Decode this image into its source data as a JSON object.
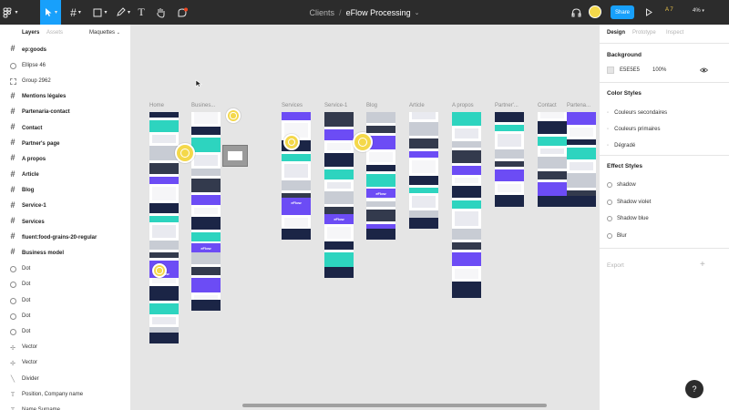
{
  "toolbar": {
    "breadcrumb": "Clients",
    "separator": "/",
    "file_name": "eFlow Processing",
    "caret": "⌄",
    "share_label": "Share",
    "multiplayer_label": "A 7",
    "zoom": "4%"
  },
  "left_panel": {
    "tabs": {
      "layers": "Layers",
      "assets": "Assets",
      "page": "Maquettes",
      "page_caret": "⌄"
    },
    "layers": [
      {
        "label": "ep:goods",
        "icon": "frame-icon",
        "bold": true
      },
      {
        "label": "Ellipse 46",
        "icon": "ellipse-icon",
        "bold": false
      },
      {
        "label": "Group 2962",
        "icon": "group-icon",
        "bold": false
      },
      {
        "label": "Mentions légales",
        "icon": "frame-icon",
        "bold": true
      },
      {
        "label": "Partenaria-contact",
        "icon": "frame-icon",
        "bold": true
      },
      {
        "label": "Contact",
        "icon": "frame-icon",
        "bold": true
      },
      {
        "label": "Partner's page",
        "icon": "frame-icon",
        "bold": true
      },
      {
        "label": "A propos",
        "icon": "frame-icon",
        "bold": true
      },
      {
        "label": "Article",
        "icon": "frame-icon",
        "bold": true
      },
      {
        "label": "Blog",
        "icon": "frame-icon",
        "bold": true
      },
      {
        "label": "Service-1",
        "icon": "frame-icon",
        "bold": true
      },
      {
        "label": "Services",
        "icon": "frame-icon",
        "bold": true
      },
      {
        "label": "fluent:food-grains-20-regular",
        "icon": "frame-icon",
        "bold": true
      },
      {
        "label": "Business model",
        "icon": "frame-icon",
        "bold": true
      },
      {
        "label": "Dot",
        "icon": "ellipse-icon",
        "bold": false
      },
      {
        "label": "Dot",
        "icon": "ellipse-icon",
        "bold": false
      },
      {
        "label": "Dot",
        "icon": "ellipse-icon",
        "bold": false
      },
      {
        "label": "Dot",
        "icon": "ellipse-icon",
        "bold": false
      },
      {
        "label": "Dot",
        "icon": "ellipse-icon",
        "bold": false
      },
      {
        "label": "Vector",
        "icon": "vector-icon",
        "bold": false
      },
      {
        "label": "Vector",
        "icon": "vector-icon",
        "bold": false
      },
      {
        "label": "Divider",
        "icon": "divider-icon",
        "bold": false
      },
      {
        "label": "Position, Company name",
        "icon": "text-icon",
        "bold": false
      },
      {
        "label": "Name Surname",
        "icon": "text-icon",
        "bold": false
      }
    ]
  },
  "canvas": {
    "frames": [
      {
        "label": "Home"
      },
      {
        "label": "Busines..."
      },
      {
        "label": "Services"
      },
      {
        "label": "Service-1"
      },
      {
        "label": "Blog"
      },
      {
        "label": "Article"
      },
      {
        "label": "A propos"
      },
      {
        "label": "Partner'..."
      },
      {
        "label": "Contact"
      },
      {
        "label": "Partena..."
      }
    ],
    "frame_texts": {
      "eflow": "eFlow"
    }
  },
  "right_panel": {
    "tabs": {
      "design": "Design",
      "prototype": "Prototype",
      "inspect": "Inspect"
    },
    "background": {
      "title": "Background",
      "color": "E5E5E5",
      "opacity": "100%"
    },
    "color_styles": {
      "title": "Color Styles",
      "items": [
        "Couleurs secondaires",
        "Couleurs primaires",
        "Dégradé"
      ]
    },
    "effect_styles": {
      "title": "Effect Styles",
      "items": [
        "shadow",
        "Shadow violet",
        "Shadow blue",
        "Blur"
      ]
    },
    "export": {
      "title": "Export",
      "add": "+"
    }
  },
  "help": {
    "label": "?"
  },
  "colors": {
    "toolbar": "#2c2c2c",
    "accent": "#18a0fb",
    "canvas": "#e5e5e5",
    "purple": "#6c4cf5",
    "navy": "#1b2546",
    "teal": "#2dd4bf",
    "yellow": "#f4d84a"
  }
}
